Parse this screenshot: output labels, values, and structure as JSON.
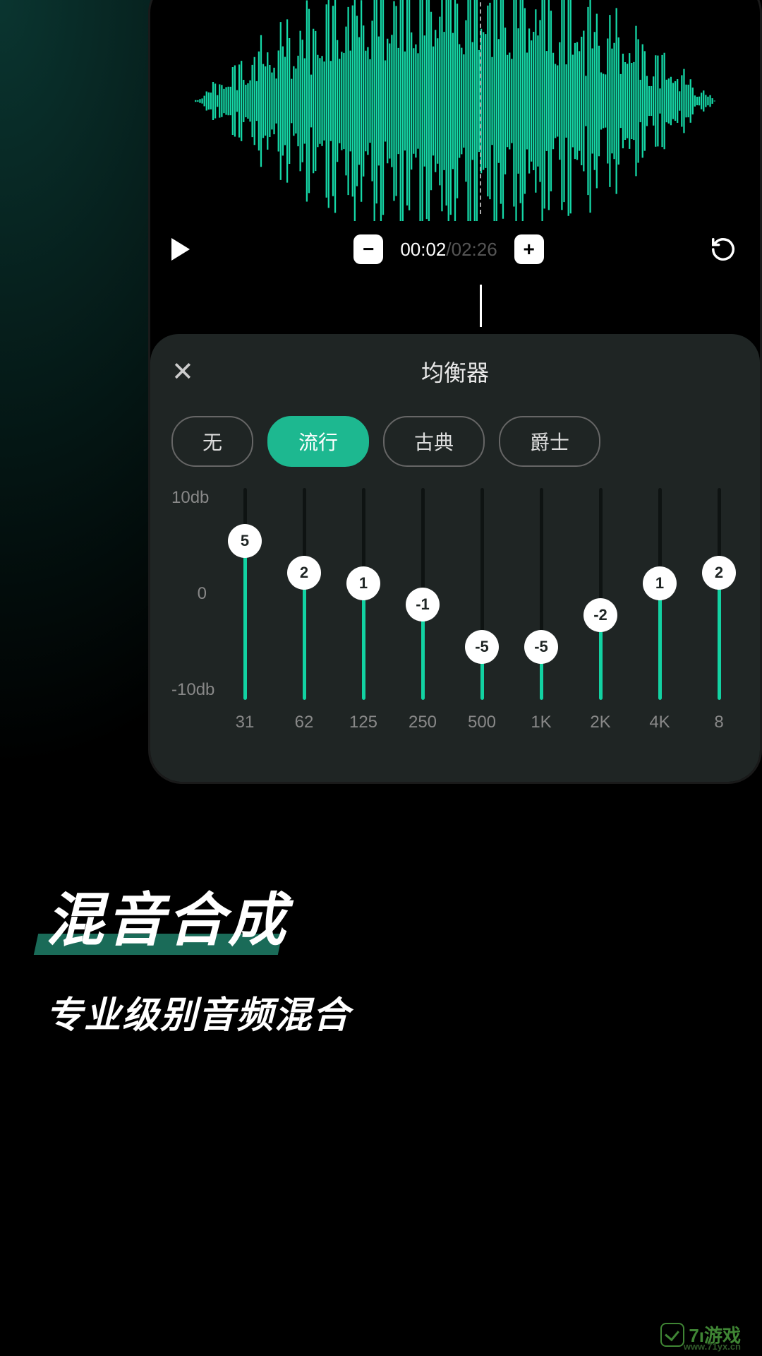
{
  "transport": {
    "current_time": "00:02",
    "total_time": "02:26",
    "minus": "−",
    "plus": "+"
  },
  "eq": {
    "title": "均衡器",
    "scale_top": "10db",
    "scale_mid": "0",
    "scale_bot": "-10db",
    "presets": [
      {
        "label": "无",
        "active": false
      },
      {
        "label": "流行",
        "active": true
      },
      {
        "label": "古典",
        "active": false
      },
      {
        "label": "爵士",
        "active": false
      }
    ],
    "bands": [
      {
        "freq": "31",
        "val": 5
      },
      {
        "freq": "62",
        "val": 2
      },
      {
        "freq": "125",
        "val": 1
      },
      {
        "freq": "250",
        "val": -1
      },
      {
        "freq": "500",
        "val": -5
      },
      {
        "freq": "1K",
        "val": -5
      },
      {
        "freq": "2K",
        "val": -2
      },
      {
        "freq": "4K",
        "val": 1
      },
      {
        "freq": "8",
        "val": 2
      }
    ]
  },
  "promo": {
    "title": "混音合成",
    "subtitle": "专业级别音频混合"
  },
  "watermark": {
    "brand": "7ı游戏",
    "url": "www.71yx.cn"
  }
}
